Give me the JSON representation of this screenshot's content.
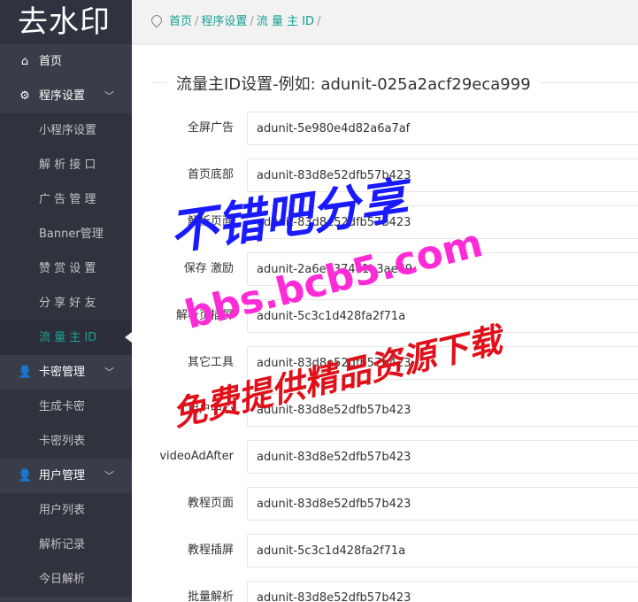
{
  "app": {
    "logo": "去水印"
  },
  "breadcrumb": {
    "items": [
      "首页",
      "程序设置",
      "流 量 主 ID"
    ],
    "trailing_sep": "/"
  },
  "sidebar": {
    "items": [
      {
        "label": "首页",
        "icon": "home-icon"
      },
      {
        "label": "程序设置",
        "icon": "gear-icon",
        "expanded": true,
        "children": [
          "小程序设置",
          "解 析 接 口",
          "广 告 管 理",
          "Banner管理",
          "赞 赏 设 置",
          "分 享 好 友",
          "流 量 主 ID"
        ]
      },
      {
        "label": "卡密管理",
        "icon": "user-icon",
        "expanded": true,
        "children": [
          "生成卡密",
          "卡密列表"
        ]
      },
      {
        "label": "用户管理",
        "icon": "user-icon",
        "expanded": true,
        "children": [
          "用户列表",
          "解析记录",
          "今日解析"
        ]
      }
    ],
    "active": "流 量 主 ID"
  },
  "form": {
    "legend": "流量主ID设置-例如:   adunit-025a2acf29eca999",
    "fields": [
      {
        "label": "全屏广告",
        "value": "adunit-5e980e4d82a6a7af"
      },
      {
        "label": "首页底部",
        "value": "adunit-83d8e52dfb57b423"
      },
      {
        "label": "解析页面",
        "value": "adunit-83d8e52dfb57b423"
      },
      {
        "label": "保存 激励",
        "value": "adunit-2a6e7374c1b3ae69"
      },
      {
        "label": "解析页插屏",
        "value": "adunit-5c3c1d428fa2f71a"
      },
      {
        "label": "其它工具",
        "value": "adunit-83d8e52dfb57b423"
      },
      {
        "label": "用户中心",
        "value": "adunit-83d8e52dfb57b423"
      },
      {
        "label": "videoAdAfter",
        "value": "adunit-83d8e52dfb57b423"
      },
      {
        "label": "教程页面",
        "value": "adunit-83d8e52dfb57b423"
      },
      {
        "label": "教程插屏",
        "value": "adunit-5c3c1d428fa2f71a"
      },
      {
        "label": "批量解析",
        "value": "adunit-83d8e52dfb57b423"
      }
    ]
  },
  "watermark": {
    "line1": "不错吧分享",
    "line2": "bbs.bcb5.com",
    "line3": "免费提供精品资源下载"
  },
  "colors": {
    "sidebar": "#393d49",
    "accent": "#1aa094"
  }
}
